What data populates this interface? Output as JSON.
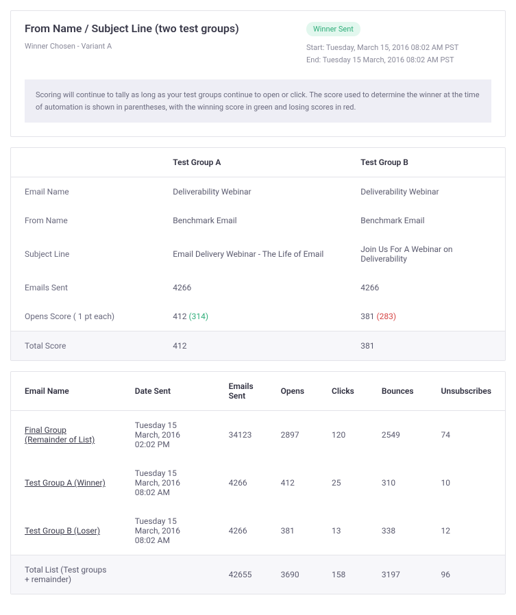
{
  "header": {
    "title": "From Name / Subject Line (two test groups)",
    "winner_chosen": "Winner Chosen - Variant A",
    "badge": "Winner Sent",
    "start": "Start: Tuesday, March 15, 2016 08:02 AM PST",
    "end": "End: Tuesday 15 March, 2016 08:02 AM PST",
    "notice": "Scoring will continue to tally as long as your test groups continue to open or click. The score used to determine the winner at the time of automation is shown in parentheses, with the winning score in green and losing scores in red."
  },
  "compare": {
    "head": {
      "blank": "",
      "a": "Test Group A",
      "b": "Test Group B"
    },
    "rows": {
      "email_name": {
        "label": "Email Name",
        "a": "Deliverability Webinar",
        "b": "Deliverability Webinar"
      },
      "from_name": {
        "label": "From Name",
        "a": "Benchmark Email",
        "b": "Benchmark Email"
      },
      "subject_line": {
        "label": "Subject Line",
        "a": "Email Delivery Webinar - The Life of Email",
        "b": "Join Us For A Webinar on Deliverability"
      },
      "emails_sent": {
        "label": "Emails Sent",
        "a": "4266",
        "b": "4266"
      },
      "opens_score": {
        "label": "Opens Score ( 1 pt each)",
        "a_value": "412",
        "a_paren": "(314)",
        "b_value": "381",
        "b_paren": "(283)"
      },
      "total": {
        "label": "Total Score",
        "a": "412",
        "b": "381"
      }
    }
  },
  "detail": {
    "head": {
      "email_name": "Email Name",
      "date_sent": "Date Sent",
      "emails_sent": "Emails Sent",
      "opens": "Opens",
      "clicks": "Clicks",
      "bounces": "Bounces",
      "unsubs": "Unsubscribes"
    },
    "rows": {
      "final": {
        "name": "Final Group (Remainder of List)",
        "date": "Tuesday 15 March, 2016 02:02 PM",
        "sent": "34123",
        "opens": "2897",
        "clicks": "120",
        "bounces": "2549",
        "unsubs": "74"
      },
      "a": {
        "name": "Test Group A (Winner)",
        "date": "Tuesday 15 March, 2016 08:02 AM",
        "sent": "4266",
        "opens": "412",
        "clicks": "25",
        "bounces": "310",
        "unsubs": "10"
      },
      "b": {
        "name": "Test Group B (Loser)",
        "date": "Tuesday 15 March, 2016 08:02 AM",
        "sent": "4266",
        "opens": "381",
        "clicks": "13",
        "bounces": "338",
        "unsubs": "12"
      },
      "total": {
        "name": "Total List (Test groups + remainder)",
        "date": "",
        "sent": "42655",
        "opens": "3690",
        "clicks": "158",
        "bounces": "3197",
        "unsubs": "96"
      }
    }
  }
}
